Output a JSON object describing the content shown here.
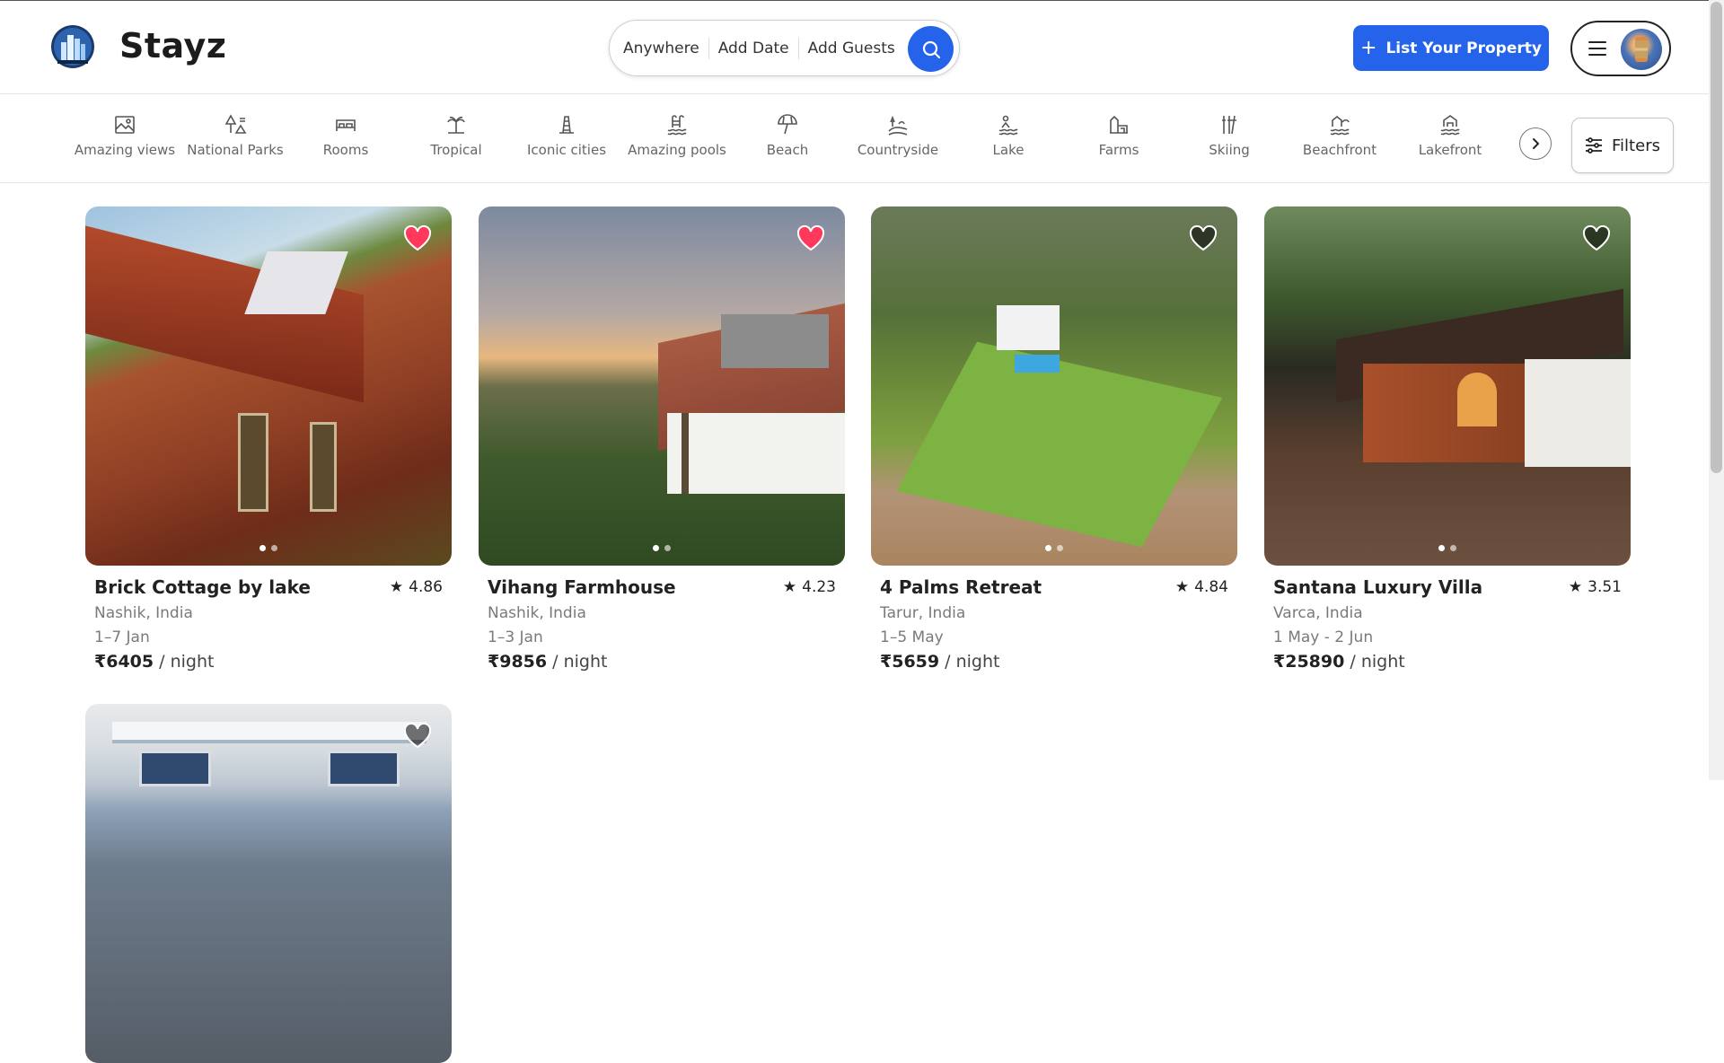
{
  "header": {
    "brand": "Stayz",
    "search": {
      "where": "Anywhere",
      "date": "Add Date",
      "guests": "Add Guests"
    },
    "list_property": "List Your Property",
    "accent_color": "#2563eb"
  },
  "categories": [
    {
      "label": "Amazing views",
      "icon": "amazing-views-icon"
    },
    {
      "label": "National Parks",
      "icon": "national-parks-icon"
    },
    {
      "label": "Rooms",
      "icon": "rooms-icon"
    },
    {
      "label": "Tropical",
      "icon": "tropical-icon"
    },
    {
      "label": "Iconic cities",
      "icon": "iconic-cities-icon"
    },
    {
      "label": "Amazing pools",
      "icon": "amazing-pools-icon"
    },
    {
      "label": "Beach",
      "icon": "beach-icon"
    },
    {
      "label": "Countryside",
      "icon": "countryside-icon"
    },
    {
      "label": "Lake",
      "icon": "lake-icon"
    },
    {
      "label": "Farms",
      "icon": "farms-icon"
    },
    {
      "label": "Skiing",
      "icon": "skiing-icon"
    },
    {
      "label": "Beachfront",
      "icon": "beachfront-icon"
    },
    {
      "label": "Lakefront",
      "icon": "lakefront-icon"
    }
  ],
  "filters_label": "Filters",
  "listings": [
    {
      "title": "Brick Cottage by lake",
      "rating": "4.86",
      "location": "Nashik, India",
      "dates": "1–7 Jan",
      "price": "₹6405",
      "unit": "/ night",
      "favorited": true
    },
    {
      "title": "Vihang Farmhouse",
      "rating": "4.23",
      "location": "Nashik, India",
      "dates": "1–3 Jan",
      "price": "₹9856",
      "unit": "/ night",
      "favorited": true
    },
    {
      "title": "4 Palms Retreat",
      "rating": "4.84",
      "location": "Tarur, India",
      "dates": "1–5 May",
      "price": "₹5659",
      "unit": "/ night",
      "favorited": false
    },
    {
      "title": "Santana Luxury Villa",
      "rating": "3.51",
      "location": "Varca, India",
      "dates": "1 May - 2 Jun",
      "price": "₹25890",
      "unit": "/ night",
      "favorited": false
    },
    {
      "favorited": false
    }
  ]
}
